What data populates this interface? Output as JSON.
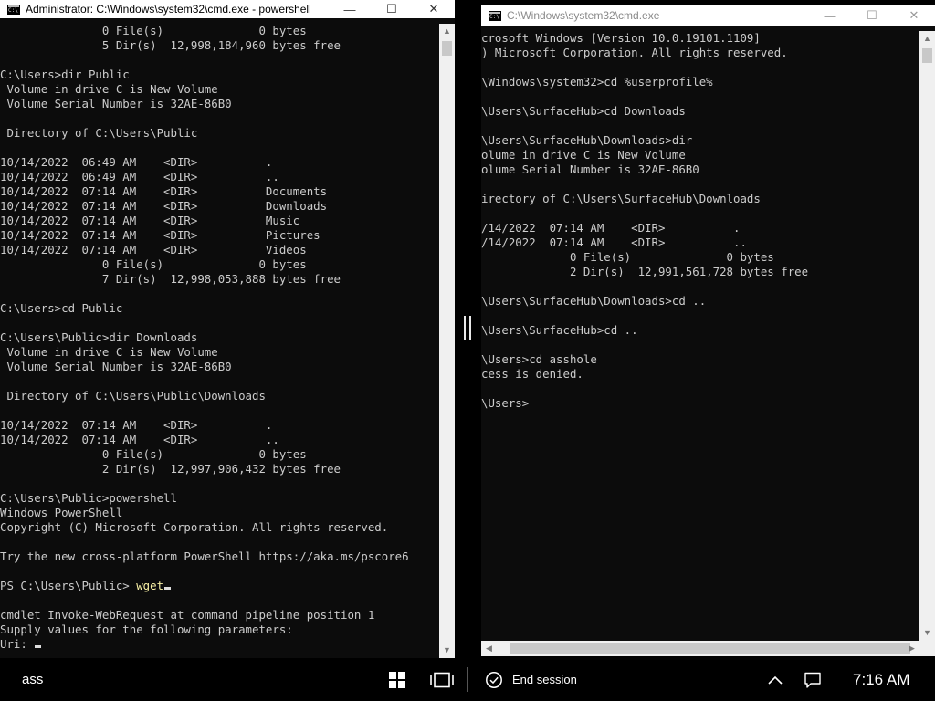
{
  "left_window": {
    "title": "Administrator: C:\\Windows\\system32\\cmd.exe - powershell",
    "lines": [
      "               0 File(s)              0 bytes",
      "               5 Dir(s)  12,998,184,960 bytes free",
      "",
      "C:\\Users>dir Public",
      " Volume in drive C is New Volume",
      " Volume Serial Number is 32AE-86B0",
      "",
      " Directory of C:\\Users\\Public",
      "",
      "10/14/2022  06:49 AM    <DIR>          .",
      "10/14/2022  06:49 AM    <DIR>          ..",
      "10/14/2022  07:14 AM    <DIR>          Documents",
      "10/14/2022  07:14 AM    <DIR>          Downloads",
      "10/14/2022  07:14 AM    <DIR>          Music",
      "10/14/2022  07:14 AM    <DIR>          Pictures",
      "10/14/2022  07:14 AM    <DIR>          Videos",
      "               0 File(s)              0 bytes",
      "               7 Dir(s)  12,998,053,888 bytes free",
      "",
      "C:\\Users>cd Public",
      "",
      "C:\\Users\\Public>dir Downloads",
      " Volume in drive C is New Volume",
      " Volume Serial Number is 32AE-86B0",
      "",
      " Directory of C:\\Users\\Public\\Downloads",
      "",
      "10/14/2022  07:14 AM    <DIR>          .",
      "10/14/2022  07:14 AM    <DIR>          ..",
      "               0 File(s)              0 bytes",
      "               2 Dir(s)  12,997,906,432 bytes free",
      "",
      "C:\\Users\\Public>powershell",
      "Windows PowerShell",
      "Copyright (C) Microsoft Corporation. All rights reserved.",
      "",
      "Try the new cross-platform PowerShell https://aka.ms/pscore6",
      "",
      "PS C:\\Users\\Public> ",
      "",
      "cmdlet Invoke-WebRequest at command pipeline position 1",
      "Supply values for the following parameters:",
      "Uri: "
    ],
    "command_text": "wget",
    "highlight_color": "#f9f1a5"
  },
  "right_window": {
    "title": "C:\\Windows\\system32\\cmd.exe",
    "lines": [
      "crosoft Windows [Version 10.0.19101.1109]",
      ") Microsoft Corporation. All rights reserved.",
      "",
      "\\Windows\\system32>cd %userprofile%",
      "",
      "\\Users\\SurfaceHub>cd Downloads",
      "",
      "\\Users\\SurfaceHub\\Downloads>dir",
      "olume in drive C is New Volume",
      "olume Serial Number is 32AE-86B0",
      "",
      "irectory of C:\\Users\\SurfaceHub\\Downloads",
      "",
      "/14/2022  07:14 AM    <DIR>          .",
      "/14/2022  07:14 AM    <DIR>          ..",
      "             0 File(s)              0 bytes",
      "             2 Dir(s)  12,991,561,728 bytes free",
      "",
      "\\Users\\SurfaceHub\\Downloads>cd ..",
      "",
      "\\Users\\SurfaceHub>cd ..",
      "",
      "\\Users>cd asshole",
      "cess is denied.",
      "",
      "\\Users>"
    ]
  },
  "titlebar_buttons": {
    "minimize": "—",
    "maximize": "☐",
    "close": "✕"
  },
  "taskbar": {
    "search_text": "ass",
    "end_session_label": "End session",
    "time": "7:16 AM",
    "icons": [
      "start-icon",
      "task-view-icon",
      "end-session-icon",
      "chevron-up-icon",
      "notifications-icon"
    ]
  }
}
